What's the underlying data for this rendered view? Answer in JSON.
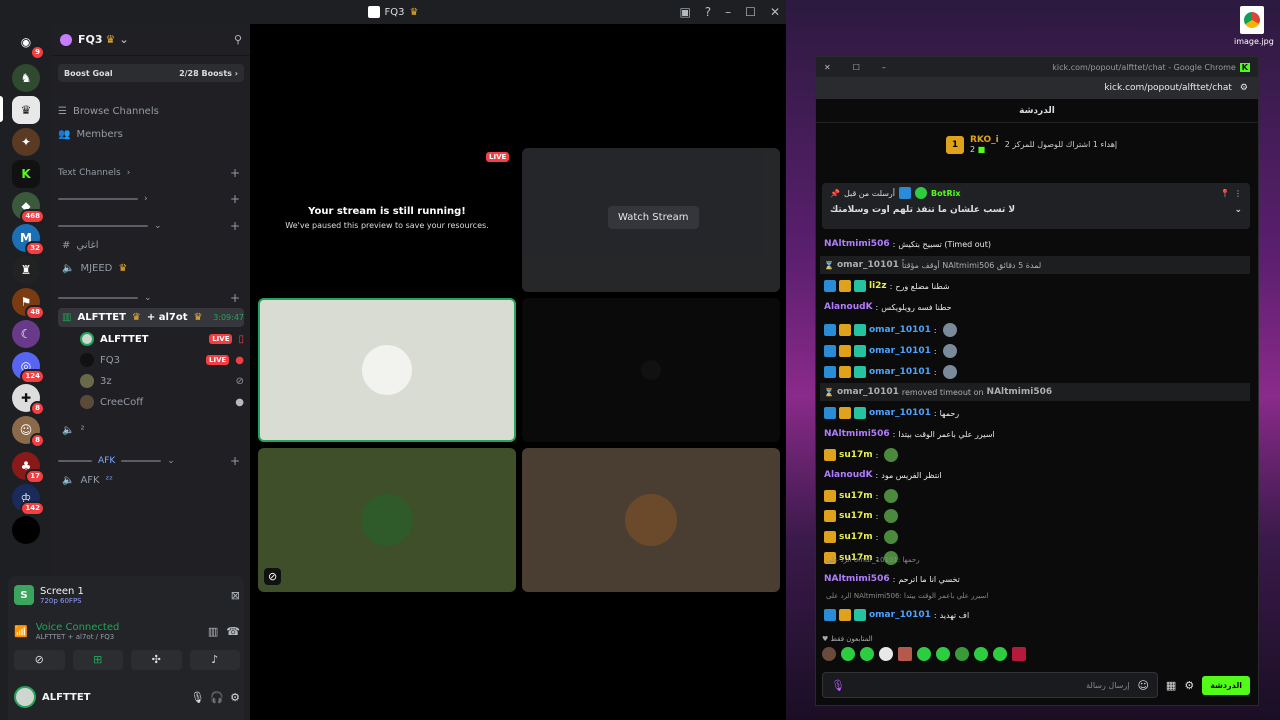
{
  "titlebar": {
    "title": "FQ3"
  },
  "servers": {
    "badges": [
      "9",
      "468",
      "32",
      "48",
      "124",
      "8",
      "8",
      "17",
      "142"
    ]
  },
  "channels": {
    "server_name": "FQ3",
    "boost_goal": "Boost Goal",
    "boost_count": "2/28 Boosts",
    "browse": "Browse Channels",
    "members": "Members",
    "text_channels": "Text Channels",
    "voice1": "اغاني",
    "voice2": "MJEED",
    "active_channel": "ALFTTET",
    "active_channel2": "+ al7ot",
    "active_time": "3:09:47",
    "users": [
      {
        "name": "ALFTTET",
        "live": "LIVE"
      },
      {
        "name": "FQ3",
        "live": "LIVE"
      },
      {
        "name": "3z"
      },
      {
        "name": "CreeCoff"
      }
    ],
    "vc_small": "²",
    "afk_cat": "AFK",
    "afk_channel": "AFK"
  },
  "screen": {
    "title": "Screen 1",
    "quality": "720p 60FPS"
  },
  "voice": {
    "status": "Voice Connected",
    "channel": "ALFTTET + al7ot / FQ3"
  },
  "user": {
    "name": "ALFTTET"
  },
  "stream": {
    "live": "LIVE",
    "title": "Your stream is still running!",
    "subtitle": "We've paused this preview to save your resources.",
    "watch": "Watch Stream"
  },
  "chrome": {
    "window_title": "kick.com/popout/alfttet/chat - Google Chrome",
    "url": "kick.com/popout/alfttet/chat"
  },
  "chat": {
    "header": "الدردشة",
    "top_gifter_rank": "1",
    "top_gifter_name": "RKO_i",
    "top_gifter_count": "2",
    "top_gifter_note": "إهداء 1 اشتراك للوصول للمركز 2",
    "pinned_by": "أرسلت من قبل",
    "pinned_user": "BotRix",
    "pinned_text": "لا تسب علشان ما تنفذ تلهم اوت وسلامتك",
    "messages": [
      {
        "user": "NAltmimi506",
        "text": "تسبيح بتكيش (Timed out)"
      },
      {
        "sys": true,
        "user": "omar_10101",
        "text": "أوقف مؤقتاً NAltmimi506 لمدة 5 دقائق"
      },
      {
        "user": "li2z",
        "text": "شطنا مضلع ورح"
      },
      {
        "user": "AlanoudK",
        "text": "حطنا فسه رويلويكس"
      },
      {
        "user": "omar_10101",
        "text": ""
      },
      {
        "user": "omar_10101",
        "text": ""
      },
      {
        "user": "omar_10101",
        "text": ""
      },
      {
        "sys": true,
        "user": "omar_10101",
        "text": "removed timeout on",
        "target": "NAltmimi506"
      },
      {
        "user": "omar_10101",
        "text": "رحمها"
      },
      {
        "user": "NAltmimi506",
        "text": "اسيرر علي باعمر الوقت بيتدا"
      },
      {
        "user": "su17m",
        "text": ""
      },
      {
        "user": "AlanoudK",
        "text": "انتظر الفريس مود"
      },
      {
        "user": "su17m",
        "text": ""
      },
      {
        "user": "su17m",
        "text": ""
      },
      {
        "user": "su17m",
        "text": ""
      },
      {
        "user": "su17m",
        "text": ""
      },
      {
        "reply": "الرد على omar_10101: رحمها",
        "user": "NAltmimi506",
        "text": "تخسي انا ما اترحم"
      },
      {
        "reply": "الرد على NAltmimi506: اسيرر علي باعمر الوقت بيتدا",
        "user": "omar_10101",
        "text": "اف تهديد"
      }
    ],
    "emote_label": "المتابعون فقط",
    "input_placeholder": "إرسال رسالة",
    "send": "الدردشة"
  },
  "desktop": {
    "file": "image.jpg"
  }
}
